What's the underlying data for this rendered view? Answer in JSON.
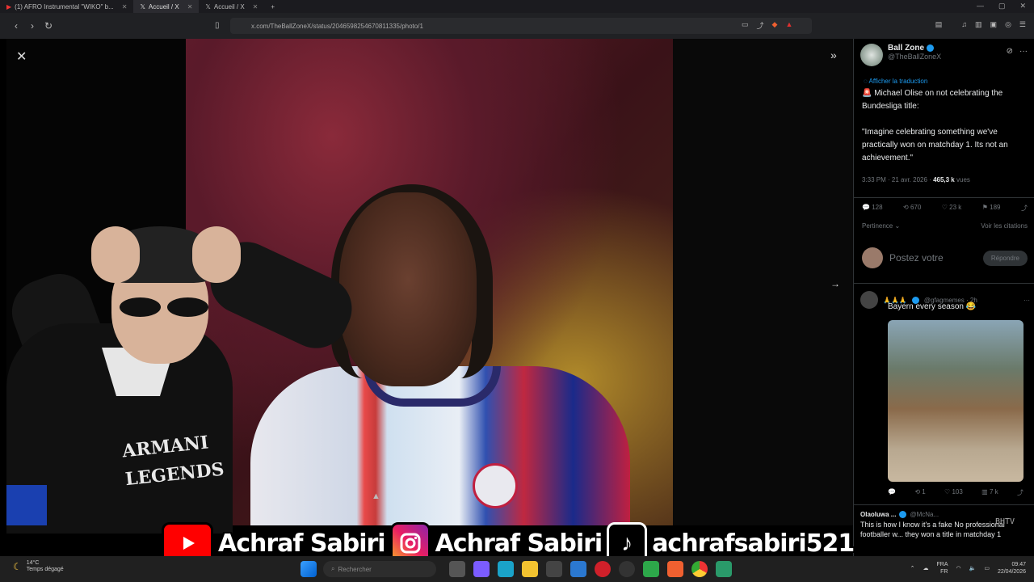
{
  "browser": {
    "tabs": [
      {
        "label": "(1) AFRO Instrumental \"WIKO\" b...",
        "active": false
      },
      {
        "label": "Accueil / X",
        "active": true
      },
      {
        "label": "Accueil / X",
        "active": false
      }
    ],
    "new_tab": "+",
    "url": "x.com/TheBallZoneX/status/2046598254670811335/photo/1"
  },
  "tweet": {
    "author_name": "Ball Zone",
    "author_handle": "@TheBallZoneX",
    "translate_link": "Afficher la traduction",
    "text": "🚨 Michael Olise on not celebrating the Bundesliga title:\n\n\"Imagine celebrating something we've practically won on matchday 1. Its not an achievement.\"",
    "timestamp": "3:33 PM · 21 avr. 2026 ·",
    "views_count": "465,3 k",
    "views_label": "vues",
    "actions": {
      "replies": "128",
      "reposts": "670",
      "likes": "23 k",
      "bookmarks": "189"
    },
    "sort_label": "Pertinence",
    "quotes_link": "Voir les citations",
    "reply_placeholder": "Postez votre",
    "reply_button": "Répondre"
  },
  "reply_2": {
    "handle": "@gfagmemes · 2h",
    "text": "Bayern every season 😂",
    "actions": {
      "replies": "",
      "reposts": "1",
      "likes": "103",
      "views": "7 k"
    }
  },
  "reply_3": {
    "name": "Olaoluwa ...",
    "handle": "@McNa...",
    "text": "This is how I know it's a fake No professional footballer w... they won a title in matchday 1"
  },
  "overlay": {
    "youtube_name": "Achraf Sabiri",
    "instagram_name": "Achraf Sabiri",
    "tiktok_name": "achrafsabiri521",
    "jersey_text_1": "ARMANI",
    "jersey_text_2": "LEGENDS",
    "watermark": "BHTV"
  },
  "taskbar": {
    "weather_temp": "14°C",
    "weather_desc": "Temps dégagé",
    "search_placeholder": "Rechercher",
    "lang_1": "FRA",
    "lang_2": "FR",
    "time": "09:47",
    "date": "22/04/2026"
  }
}
